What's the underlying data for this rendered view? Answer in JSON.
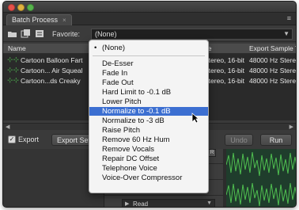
{
  "panel": {
    "tab_label": "Batch Process",
    "close_glyph": "×",
    "menu_glyph": "≡"
  },
  "toolbar": {
    "favorite_label": "Favorite:",
    "favorite_value": "(None)"
  },
  "table": {
    "headers": {
      "name": "Name",
      "type": "pe",
      "format": "Export Sample T"
    },
    "rows": [
      {
        "name": "Cartoon Balloon Fart",
        "type": "Stereo, 16-bit",
        "format": "48000 Hz Stere"
      },
      {
        "name": "Cartoon... Air Squeal",
        "type": "Stereo, 16-bit",
        "format": "48000 Hz Stere"
      },
      {
        "name": "Cartoon...ds Creaky",
        "type": "Stereo, 16-bit",
        "format": "48000 Hz Stere"
      }
    ]
  },
  "bottom": {
    "export_checkbox_label": "Export",
    "export_settings_label": "Export Settin",
    "undo_label": "Undo",
    "run_label": "Run"
  },
  "editor": {
    "read_label": "Read",
    "r_label": "R"
  },
  "menu": {
    "selected_top": "(None)",
    "items": [
      "De-Esser",
      "Fade In",
      "Fade Out",
      "Hard Limit to -0.1 dB",
      "Lower Pitch",
      "Normalize to -0.1 dB",
      "Normalize to -3 dB",
      "Raise Pitch",
      "Remove 60 Hz Hum",
      "Remove Vocals",
      "Repair DC Offset",
      "Telephone Voice",
      "Voice-Over Compressor"
    ],
    "highlighted": "Normalize to -0.1 dB"
  },
  "colors": {
    "menu_highlight": "#3c6fd1",
    "wave_green": "#4fbf50",
    "panel_bg": "#3a3a3a"
  }
}
